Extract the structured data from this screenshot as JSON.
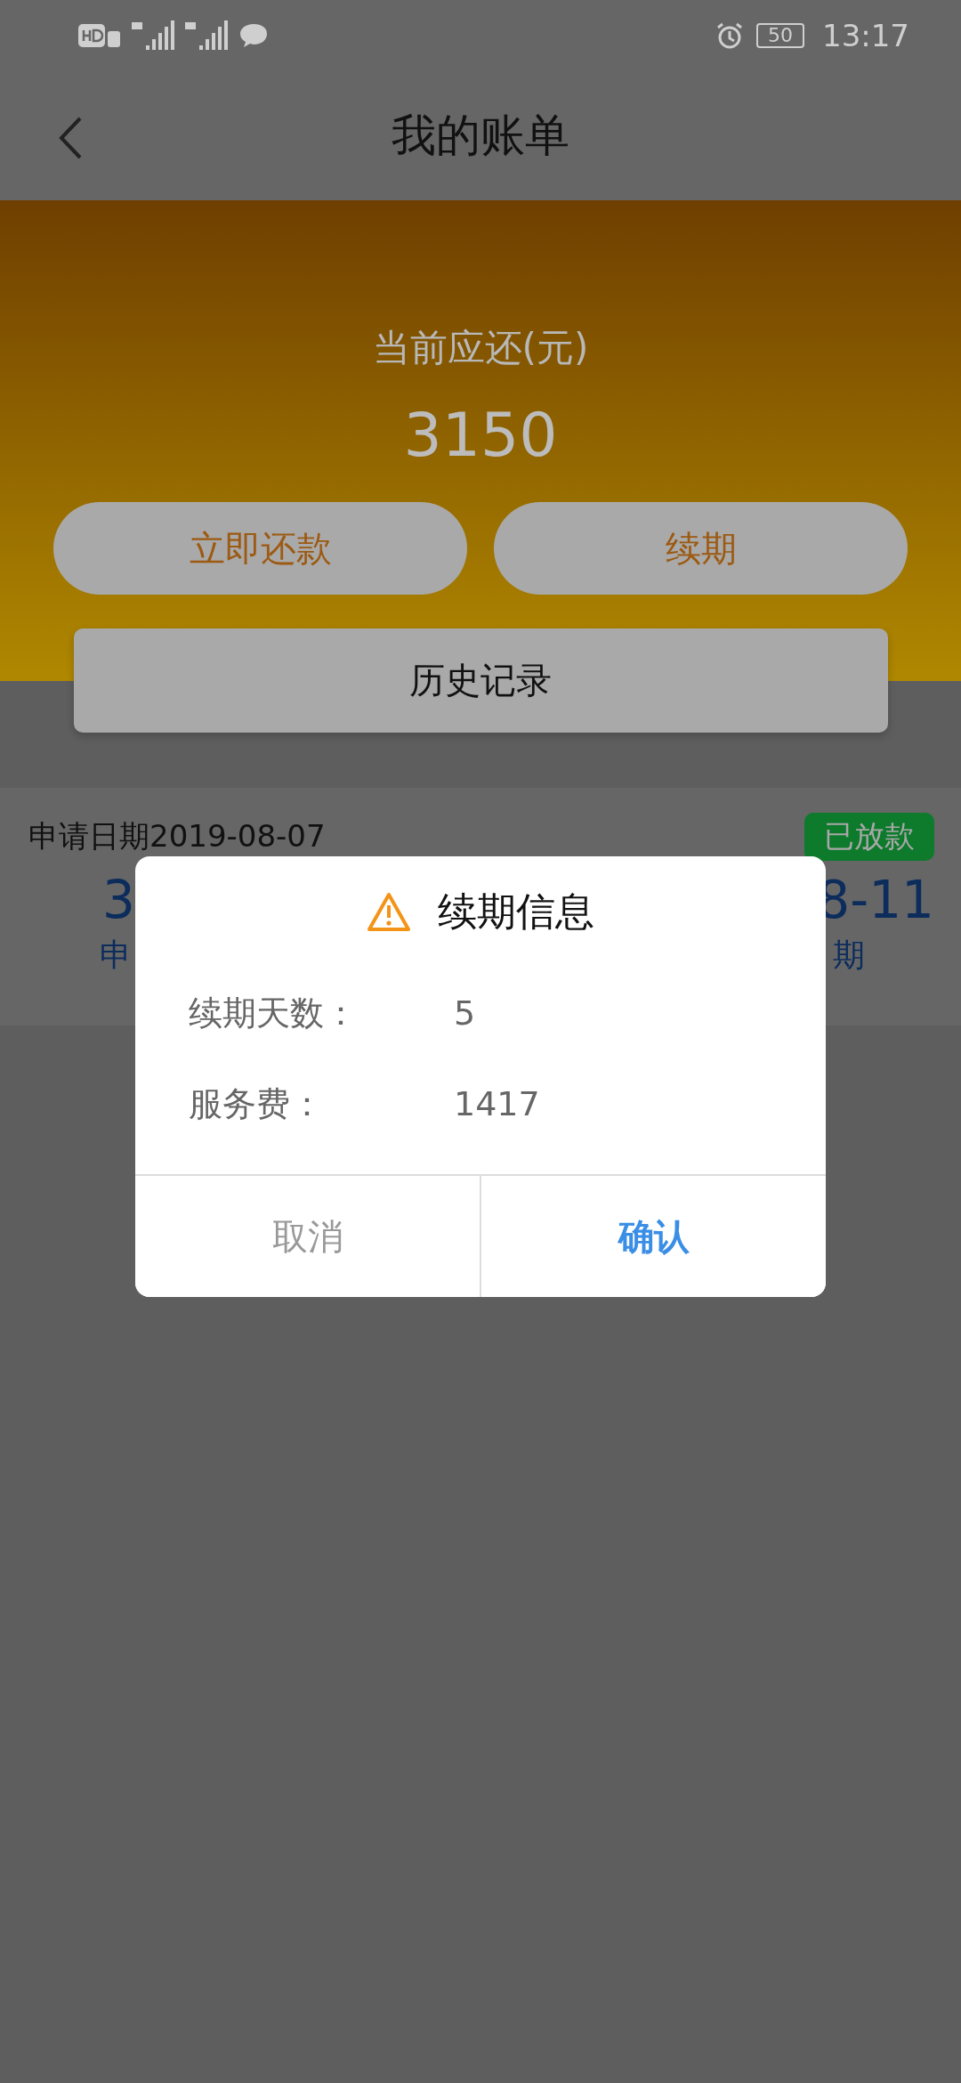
{
  "status_bar": {
    "battery": "50",
    "time": "13:17"
  },
  "header": {
    "title": "我的账单"
  },
  "summary": {
    "label": "当前应还(元)",
    "amount": "3150",
    "buttons": [
      {
        "label": "立即还款"
      },
      {
        "label": "续期"
      }
    ],
    "history": "历史记录"
  },
  "bill": {
    "date": "申请日期2019-08-07",
    "status": "已放款",
    "left_value": "3",
    "right_value": "8-11",
    "left_caption": "申",
    "right_caption": "期"
  },
  "dialog": {
    "title": "续期信息",
    "rows": [
      {
        "label": "续期天数：",
        "value": "5"
      },
      {
        "label": "服务费：",
        "value": "1417"
      }
    ],
    "buttons": [
      {
        "label": "取消",
        "kind": "cancel"
      },
      {
        "label": "确认",
        "kind": "confirm"
      }
    ]
  }
}
